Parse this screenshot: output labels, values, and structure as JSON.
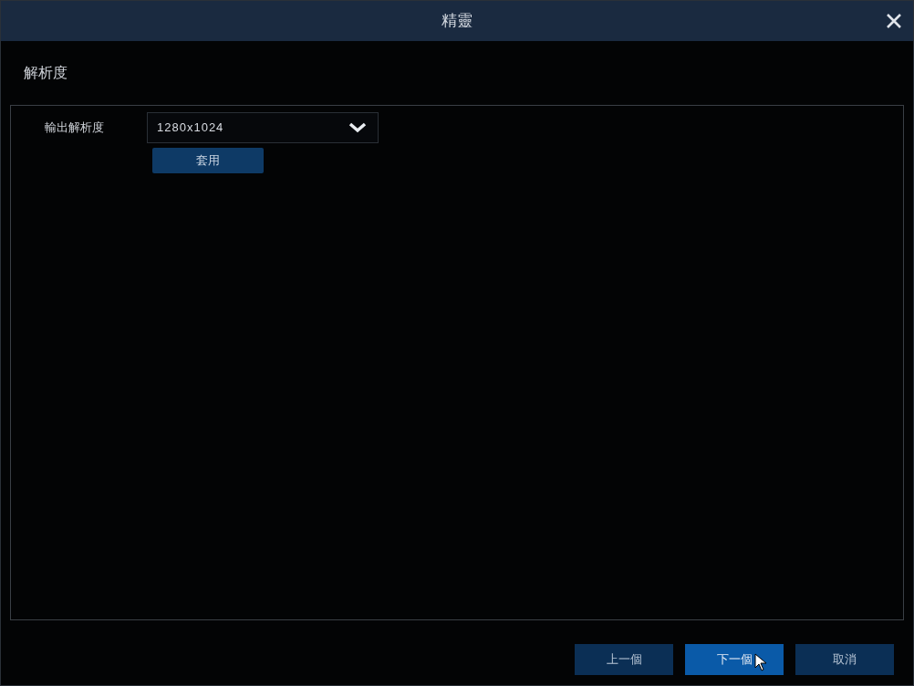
{
  "window": {
    "title": "精靈"
  },
  "section": {
    "title": "解析度"
  },
  "fields": [
    {
      "label": "輸出解析度",
      "value": "1280x1024"
    }
  ],
  "apply_button": "套用",
  "footer_buttons": [
    {
      "label": "上一個",
      "selected": false
    },
    {
      "label": "下一個",
      "selected": true
    },
    {
      "label": "取消",
      "selected": false
    }
  ]
}
